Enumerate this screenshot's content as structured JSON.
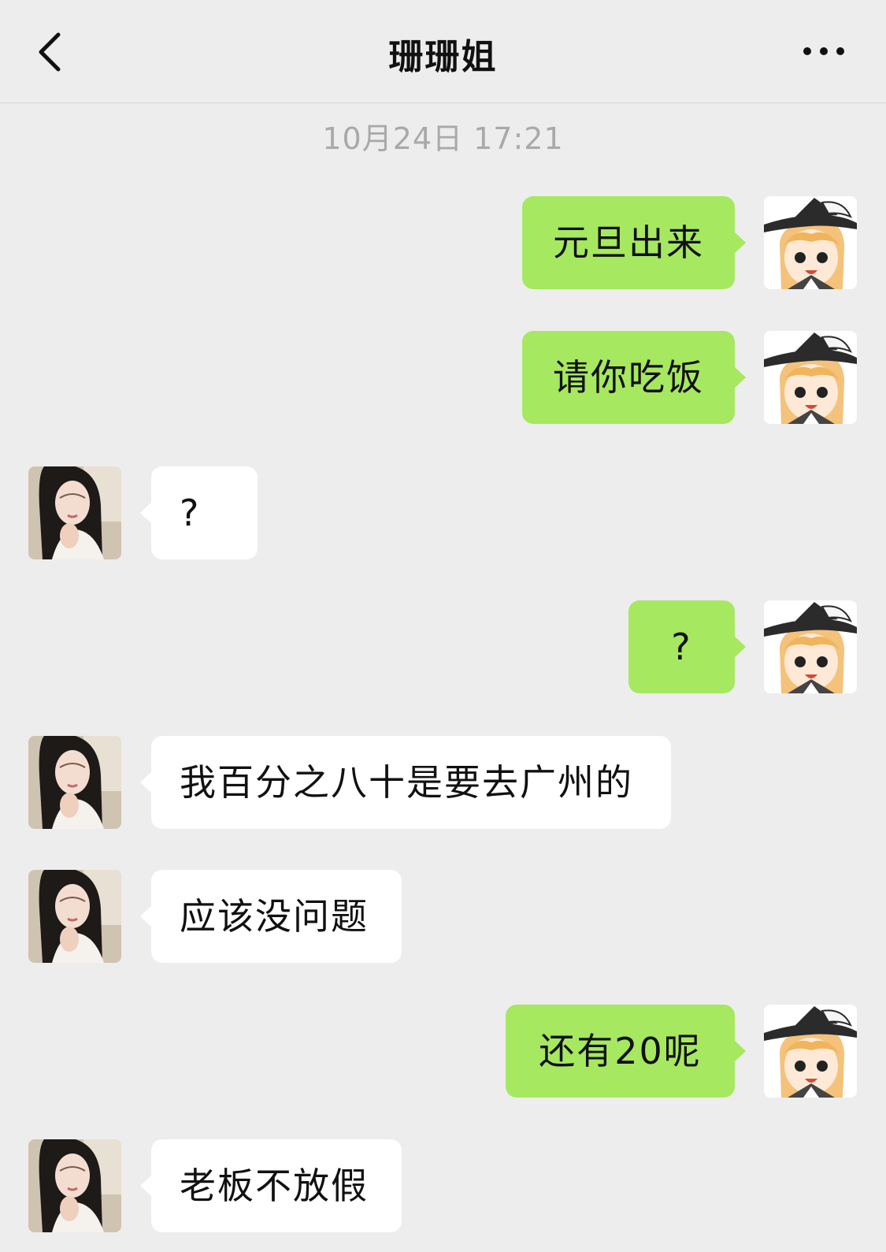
{
  "header": {
    "title": "珊珊姐",
    "back_icon": "chevron-left-icon",
    "more_icon": "more-dots-icon"
  },
  "timestamp": "10月24日 17:21",
  "colors": {
    "background": "#ededed",
    "me_bubble": "#a6e860",
    "them_bubble": "#ffffff"
  },
  "messages": [
    {
      "from": "me",
      "text": "元旦出来"
    },
    {
      "from": "me",
      "text": "请你吃饭"
    },
    {
      "from": "them",
      "text": "?"
    },
    {
      "from": "me",
      "text": "?"
    },
    {
      "from": "them",
      "text": "我百分之八十是要去广州的"
    },
    {
      "from": "them",
      "text": "应该没问题"
    },
    {
      "from": "me",
      "text": "还有20呢"
    },
    {
      "from": "them",
      "text": "老板不放假"
    }
  ]
}
